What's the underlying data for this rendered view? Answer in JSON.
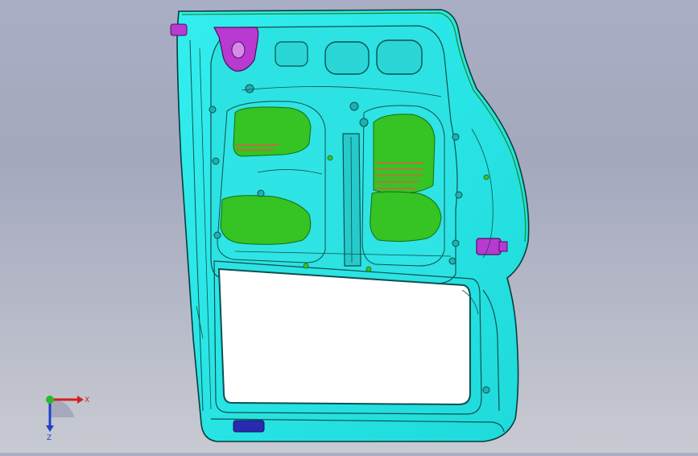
{
  "viewport": {
    "background_top": "#a9aec4",
    "background_bottom": "#c8cad2"
  },
  "model": {
    "panel_color": "#27e6e6",
    "panel_edge_color": "#0a3c3c",
    "foam_color": "#35c423",
    "bracket_color": "#b93ad0",
    "latch_color": "#2a2ab0",
    "stripe_color": "#e05a4a"
  },
  "triad": {
    "x_label": "X",
    "z_label": "Z",
    "x_color": "#d62020",
    "y_color": "#2cb82c",
    "z_color": "#2040c8"
  }
}
